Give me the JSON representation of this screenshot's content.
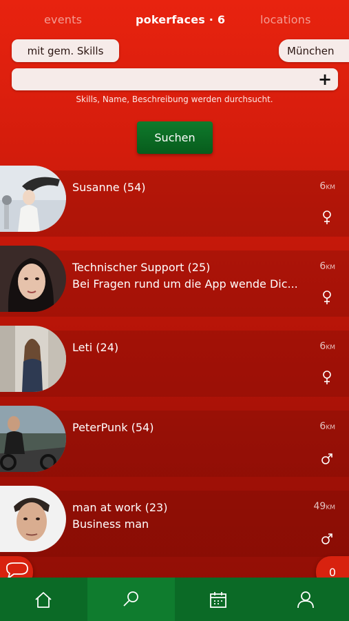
{
  "tabs": [
    {
      "label": "events"
    },
    {
      "label": "pokerfaces · 6"
    },
    {
      "label": "locations"
    }
  ],
  "filters": {
    "skills_label": "mit gem. Skills",
    "city_label": "München"
  },
  "search": {
    "value": "",
    "placeholder": "",
    "hint": "Skills, Name, Beschreibung werden durchsucht.",
    "button_label": "Suchen"
  },
  "profiles": [
    {
      "name": "Susanne (54)",
      "description": "",
      "distance": "6",
      "unit": "KM",
      "gender": "female"
    },
    {
      "name": "Technischer Support (25)",
      "description": "Bei Fragen rund um die App wende Dic...",
      "distance": "6",
      "unit": "KM",
      "gender": "female"
    },
    {
      "name": "Leti (24)",
      "description": "",
      "distance": "6",
      "unit": "KM",
      "gender": "female"
    },
    {
      "name": "PeterPunk (54)",
      "description": "",
      "distance": "6",
      "unit": "KM",
      "gender": "male"
    },
    {
      "name": "man at work (23)",
      "description": "Business man",
      "distance": "49",
      "unit": "KM",
      "gender": "male"
    }
  ],
  "fabs": {
    "chat_icon": "chat-bubble-icon",
    "count": "0"
  },
  "nav": [
    {
      "icon": "home-icon",
      "active": false
    },
    {
      "icon": "search-icon",
      "active": true
    },
    {
      "icon": "calendar-icon",
      "active": false
    },
    {
      "icon": "user-icon",
      "active": false
    }
  ],
  "colors": {
    "background": "#d31c0c",
    "accent_green": "#0b6a26",
    "chip_bg": "#f6ebe9"
  }
}
